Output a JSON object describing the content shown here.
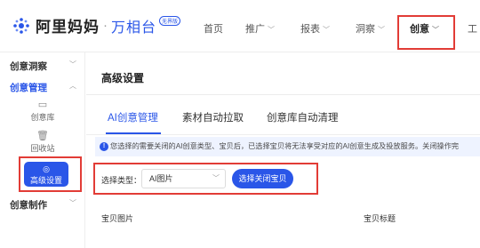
{
  "brand": {
    "main": "阿里妈妈",
    "dot": "·",
    "sub": "万相台",
    "badge": "无界版"
  },
  "nav": [
    {
      "label": "首页",
      "has_chevron": false
    },
    {
      "label": "推广",
      "has_chevron": true
    },
    {
      "label": "报表",
      "has_chevron": true
    },
    {
      "label": "洞察",
      "has_chevron": true
    },
    {
      "label": "创意",
      "has_chevron": true,
      "active": true
    },
    {
      "label": "工",
      "has_chevron": false
    }
  ],
  "sidebar": {
    "groups": [
      {
        "label": "创意洞察",
        "chevron": "﹀"
      },
      {
        "label": "创意管理",
        "chevron": "︿",
        "expanded": true
      },
      {
        "label": "创意制作",
        "chevron": "﹀"
      }
    ],
    "items": [
      {
        "label": "创意库",
        "icon": "folder-icon"
      },
      {
        "label": "回收站",
        "icon": "trash-icon"
      },
      {
        "label": "高级设置",
        "icon": "settings-icon",
        "active": true
      }
    ]
  },
  "main": {
    "title": "高级设置",
    "tabs": [
      {
        "label": "AI创意管理",
        "active": true
      },
      {
        "label": "素材自动拉取"
      },
      {
        "label": "创意库自动清理"
      }
    ],
    "notice": "您选择的需要关闭的AI创意类型、宝贝后，已选择宝贝将无法享受对应的AI创意生成及投放服务。关闭操作完",
    "filter": {
      "label": "选择类型：",
      "select_value": "AI图片",
      "button": "选择关闭宝贝"
    },
    "columns": [
      "宝贝图片",
      "宝贝标题"
    ]
  },
  "colors": {
    "accent": "#2a56e8",
    "highlight_box": "#e23c36",
    "notice_bg": "#eef3ff"
  }
}
